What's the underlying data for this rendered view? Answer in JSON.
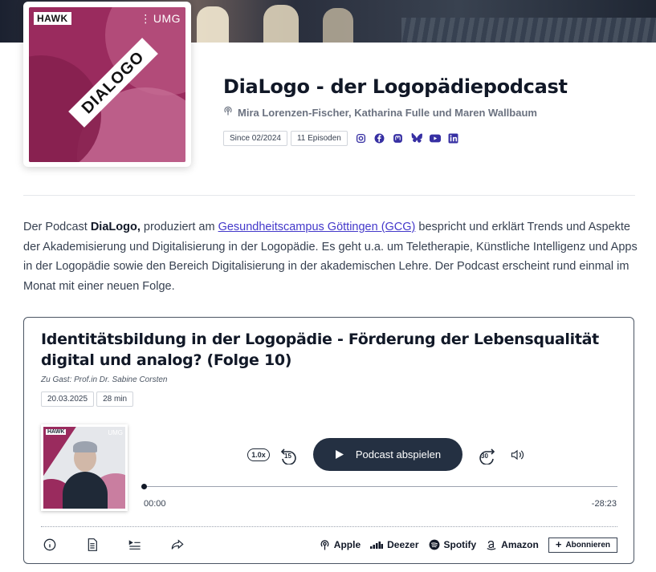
{
  "podcast": {
    "title": "DiaLogo - der Logopädiepodcast",
    "authors": "Mira Lorenzen-Fischer, Katharina Fulle und Maren Wallbaum",
    "since": "Since 02/2024",
    "episodes_count": "11 Episoden",
    "cover": {
      "logo_left": "HAWK",
      "logo_right": "UMG",
      "banner": "DIALOGO"
    },
    "social": [
      {
        "icon": "instagram-icon"
      },
      {
        "icon": "facebook-icon"
      },
      {
        "icon": "mastodon-icon"
      },
      {
        "icon": "bluesky-icon"
      },
      {
        "icon": "youtube-icon"
      },
      {
        "icon": "linkedin-icon"
      }
    ]
  },
  "description": {
    "part1": "Der Podcast ",
    "bold": "DiaLogo,",
    "part2": " produziert am ",
    "link": "Gesundheitscampus Göttingen (GCG)",
    "part3": " bespricht und erklärt Trends und Aspekte der Akademisierung und Digitalisierung in der Logopädie. Es geht u.a. um Teletherapie, Künstliche Intelligenz und Apps in der Logopädie sowie den Bereich Digitalisierung in der akademischen Lehre. Der Podcast erscheint rund einmal im Monat mit einer neuen Folge."
  },
  "episode": {
    "title": "Identitätsbildung in der Logopädie - Förderung der Lebensqualität digital und analog? (Folge 10)",
    "guest": "Zu Gast: Prof.in Dr. Sabine Corsten",
    "date": "20.03.2025",
    "duration": "28 min",
    "cover": {
      "logo_left": "HAWK",
      "logo_right": "UMG"
    }
  },
  "player": {
    "speed": "1.0x",
    "rewind": "15",
    "forward": "30",
    "play_label": "Podcast abspielen",
    "time_current": "00:00",
    "time_remaining": "-28:23",
    "progress": 0
  },
  "bottom": {
    "platforms": [
      {
        "label": "Apple",
        "icon": "podcast-icon"
      },
      {
        "label": "Deezer",
        "icon": "deezer-icon"
      },
      {
        "label": "Spotify",
        "icon": "spotify-icon"
      },
      {
        "label": "Amazon",
        "icon": "amazon-icon"
      }
    ],
    "subscribe": "Abonnieren"
  },
  "colors": {
    "brand_magenta": "#9a2b5e",
    "accent": "#3730a3",
    "play_button": "#243042"
  }
}
